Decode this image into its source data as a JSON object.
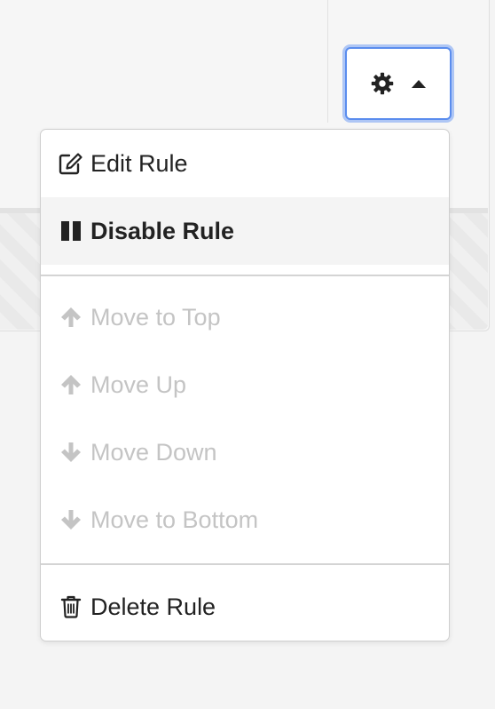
{
  "gear_toggle": {
    "icons": [
      "gear-icon",
      "caret-up-icon"
    ],
    "focus_color": "#5b8dee"
  },
  "menu": {
    "edit_label": "Edit Rule",
    "disable_label": "Disable Rule",
    "move_top_label": "Move to Top",
    "move_up_label": "Move Up",
    "move_down_label": "Move Down",
    "move_bottom_label": "Move to Bottom",
    "delete_label": "Delete Rule"
  },
  "colors": {
    "text": "#222222",
    "disabled_text": "#c4c4c4",
    "hover_bg": "#f4f4f4",
    "divider": "#d4d4d4"
  }
}
